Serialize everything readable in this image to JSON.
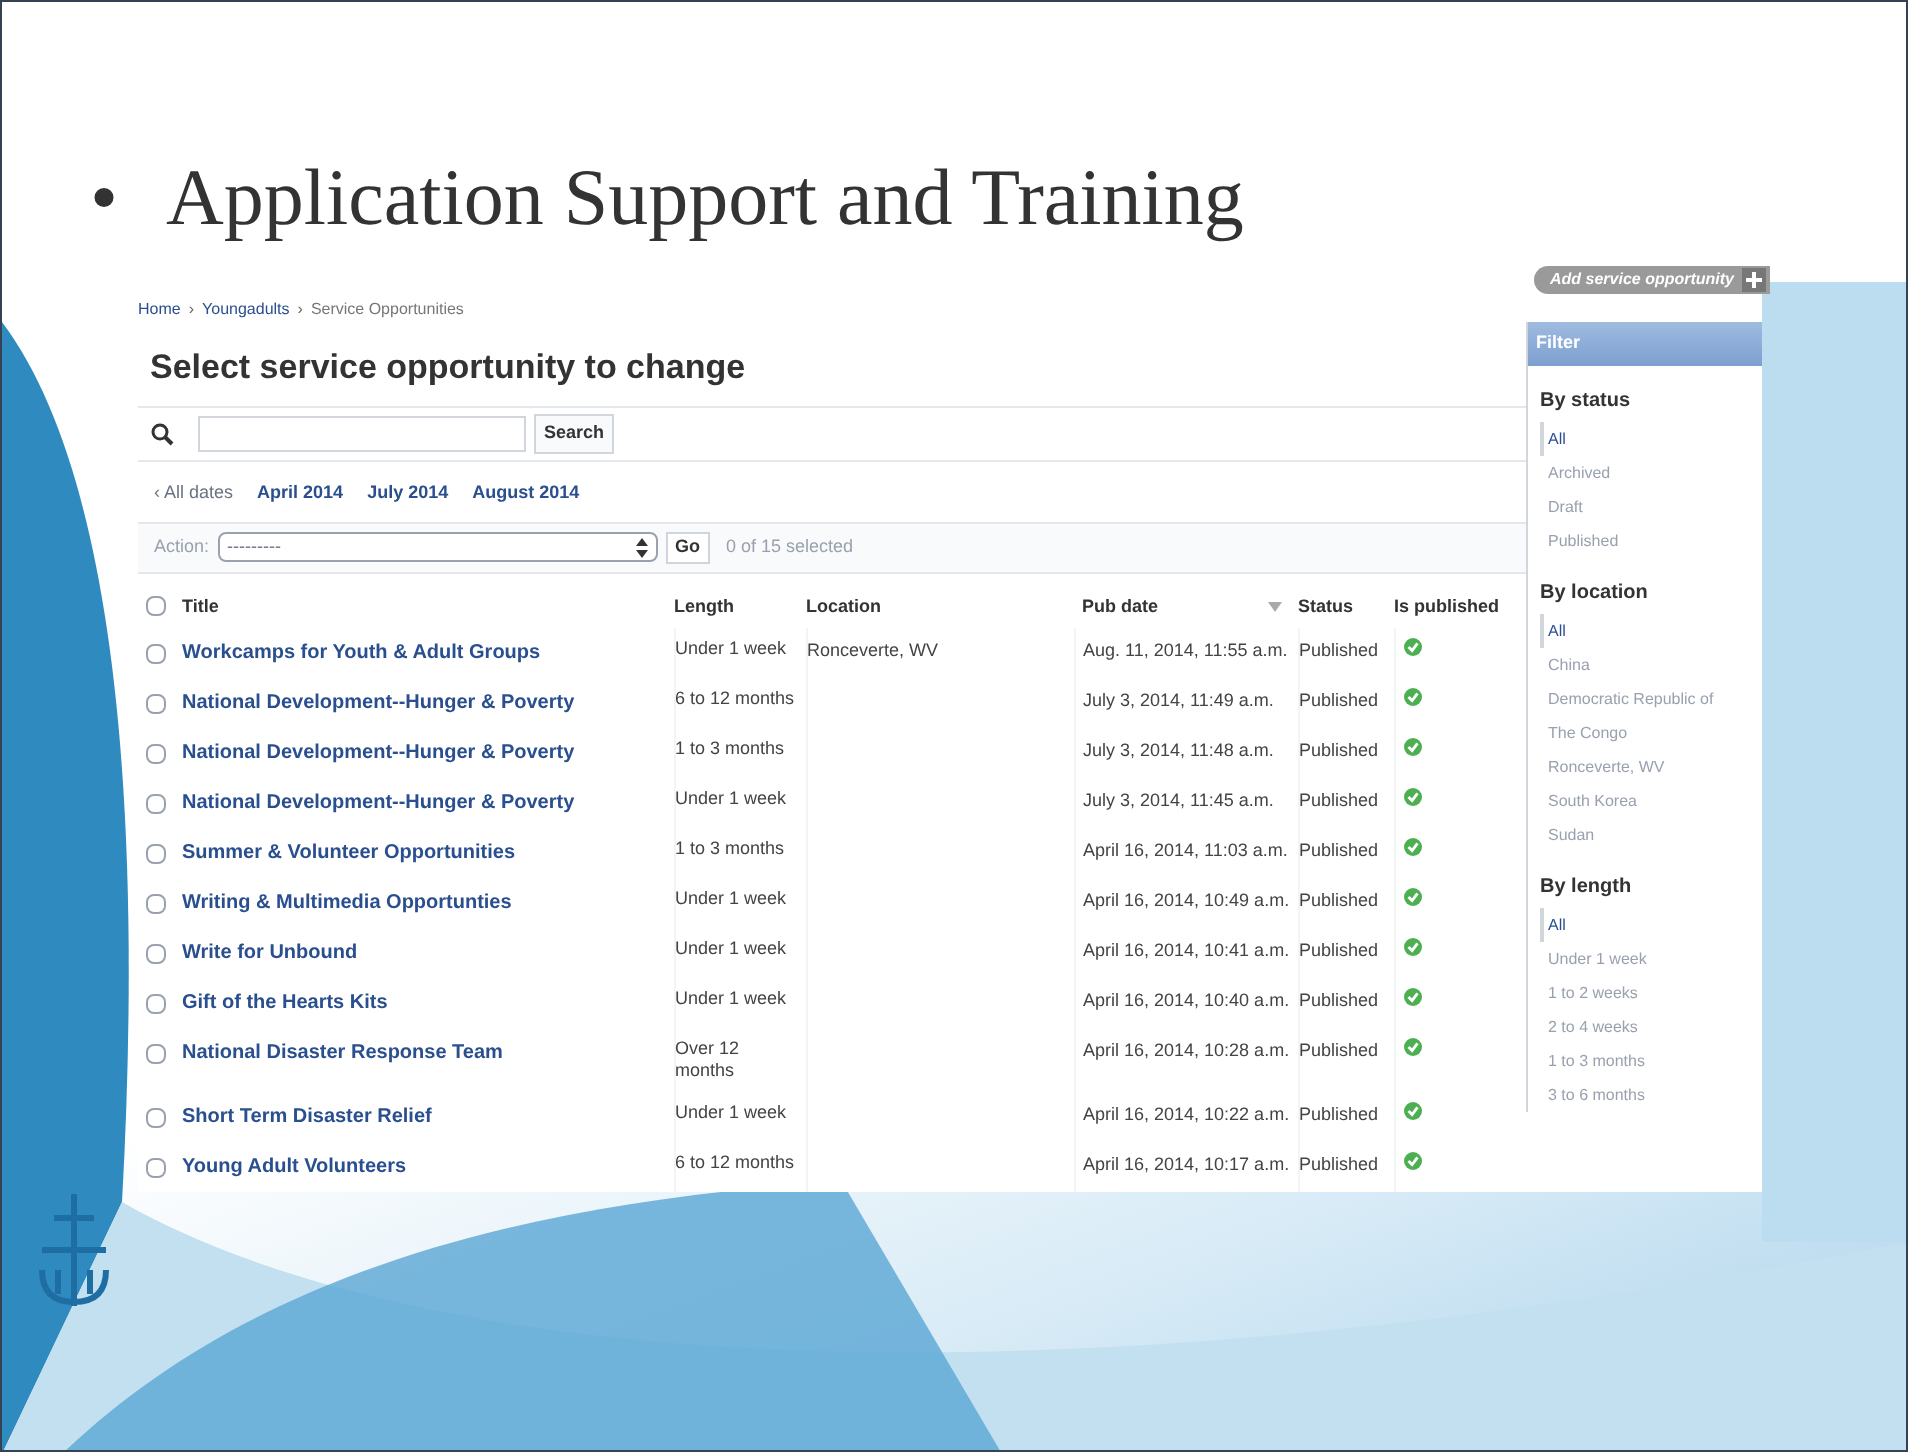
{
  "slide": {
    "bullet": "•",
    "title": "Application Support and Training"
  },
  "breadcrumbs": {
    "separator": "›",
    "items": [
      "Home",
      "Youngadults",
      "Service Opportunities"
    ]
  },
  "heading": "Select service opportunity to change",
  "add_button": {
    "label": "Add service opportunity"
  },
  "search": {
    "button": "Search"
  },
  "date_filter": [
    {
      "label": "‹ All dates",
      "selected": true
    },
    {
      "label": "April 2014",
      "selected": false
    },
    {
      "label": "July 2014",
      "selected": false
    },
    {
      "label": "August 2014",
      "selected": false
    }
  ],
  "action": {
    "label": "Action:",
    "value": "---------",
    "go": "Go",
    "counter": "0 of 15 selected"
  },
  "table": {
    "select_all_checked": false,
    "columns": [
      {
        "label": "Title",
        "sorted": false
      },
      {
        "label": "Length",
        "sorted": false
      },
      {
        "label": "Location",
        "sorted": false
      },
      {
        "label": "Pub date",
        "sorted": true
      },
      {
        "label": "Status",
        "sorted": false
      },
      {
        "label": "Is published",
        "sorted": false
      }
    ],
    "rows": [
      {
        "checked": false,
        "title": "Workcamps for Youth & Adult Groups",
        "length": "Under 1 week",
        "location": "Ronceverte, WV",
        "pub_date": "Aug. 11, 2014, 11:55 a.m.",
        "status": "Published",
        "is_published": true
      },
      {
        "checked": false,
        "title": "National Development--Hunger & Poverty",
        "length": "6 to 12 months",
        "location": "",
        "pub_date": "July 3, 2014, 11:49 a.m.",
        "status": "Published",
        "is_published": true
      },
      {
        "checked": false,
        "title": "National Development--Hunger & Poverty",
        "length": "1 to 3 months",
        "location": "",
        "pub_date": "July 3, 2014, 11:48 a.m.",
        "status": "Published",
        "is_published": true
      },
      {
        "checked": false,
        "title": "National Development--Hunger & Poverty",
        "length": "Under 1 week",
        "location": "",
        "pub_date": "July 3, 2014, 11:45 a.m.",
        "status": "Published",
        "is_published": true
      },
      {
        "checked": false,
        "title": "Summer & Volunteer Opportunities",
        "length": "1 to 3 months",
        "location": "",
        "pub_date": "April 16, 2014, 11:03 a.m.",
        "status": "Published",
        "is_published": true
      },
      {
        "checked": false,
        "title": "Writing & Multimedia Opportunties",
        "length": "Under 1 week",
        "location": "",
        "pub_date": "April 16, 2014, 10:49 a.m.",
        "status": "Published",
        "is_published": true
      },
      {
        "checked": false,
        "title": "Write for Unbound",
        "length": "Under 1 week",
        "location": "",
        "pub_date": "April 16, 2014, 10:41 a.m.",
        "status": "Published",
        "is_published": true
      },
      {
        "checked": false,
        "title": "Gift of the Hearts Kits",
        "length": "Under 1 week",
        "location": "",
        "pub_date": "April 16, 2014, 10:40 a.m.",
        "status": "Published",
        "is_published": true
      },
      {
        "checked": false,
        "title": "National Disaster Response Team",
        "length": "Over 12 months",
        "location": "",
        "pub_date": "April 16, 2014, 10:28 a.m.",
        "status": "Published",
        "is_published": true
      },
      {
        "checked": false,
        "title": "Short Term Disaster Relief",
        "length": "Under 1 week",
        "location": "",
        "pub_date": "April 16, 2014, 10:22 a.m.",
        "status": "Published",
        "is_published": true
      },
      {
        "checked": false,
        "title": "Young Adult Volunteers",
        "length": "6 to 12 months",
        "location": "",
        "pub_date": "April 16, 2014, 10:17 a.m.",
        "status": "Published",
        "is_published": true
      }
    ]
  },
  "filter": {
    "title": "Filter",
    "groups": [
      {
        "title": "By status",
        "options": [
          {
            "label": "All",
            "selected": true
          },
          {
            "label": "Archived",
            "selected": false
          },
          {
            "label": "Draft",
            "selected": false
          },
          {
            "label": "Published",
            "selected": false
          }
        ]
      },
      {
        "title": "By location",
        "options": [
          {
            "label": "All",
            "selected": true
          },
          {
            "label": "China",
            "selected": false
          },
          {
            "label": "Democratic Republic of The Congo",
            "selected": false
          },
          {
            "label": "Ronceverte, WV",
            "selected": false
          },
          {
            "label": "South Korea",
            "selected": false
          },
          {
            "label": "Sudan",
            "selected": false
          }
        ]
      },
      {
        "title": "By length",
        "options": [
          {
            "label": "All",
            "selected": true
          },
          {
            "label": "Under 1 week",
            "selected": false
          },
          {
            "label": "1 to 2 weeks",
            "selected": false
          },
          {
            "label": "2 to 4 weeks",
            "selected": false
          },
          {
            "label": "1 to 3 months",
            "selected": false
          },
          {
            "label": "3 to 6 months",
            "selected": false
          }
        ]
      }
    ]
  }
}
